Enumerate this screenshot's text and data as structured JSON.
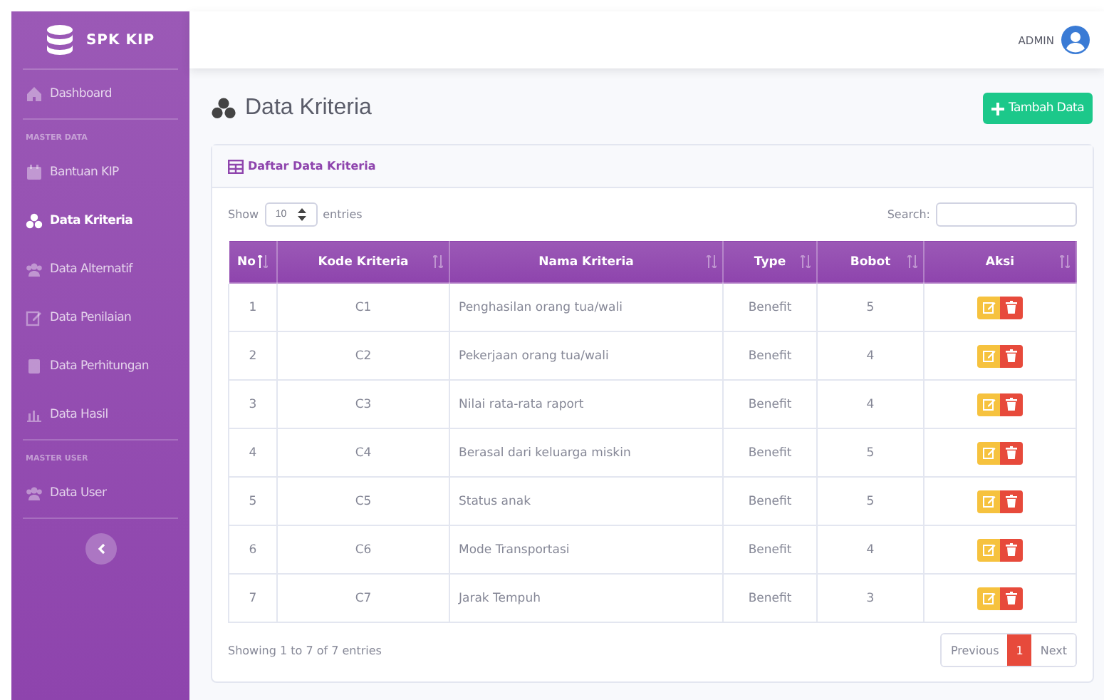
{
  "sidebar": {
    "brand": "SPK KIP",
    "nav": [
      {
        "kind": "link",
        "label": "Dashboard",
        "selected": false
      },
      {
        "kind": "divider"
      },
      {
        "kind": "heading",
        "label": "MASTER DATA"
      },
      {
        "kind": "link",
        "label": "Bantuan KIP",
        "selected": false
      },
      {
        "kind": "link",
        "label": "Data Kriteria",
        "selected": true
      },
      {
        "kind": "link",
        "label": "Data Alternatif",
        "selected": false
      },
      {
        "kind": "link",
        "label": "Data Penilaian",
        "selected": false
      },
      {
        "kind": "link",
        "label": "Data Perhitungan",
        "selected": false
      },
      {
        "kind": "link",
        "label": "Data Hasil",
        "selected": false
      },
      {
        "kind": "divider"
      },
      {
        "kind": "heading",
        "label": "MASTER USER"
      },
      {
        "kind": "link",
        "label": "Data User",
        "selected": false
      },
      {
        "kind": "divider"
      }
    ]
  },
  "topbar": {
    "user": "ADMIN"
  },
  "page": {
    "title": "Data Kriteria",
    "add_button": "Tambah Data"
  },
  "card": {
    "title": "Daftar Data Kriteria",
    "show_label": "Show",
    "page_size": "10",
    "entries_label": "entries",
    "search_label": "Search:",
    "columns": [
      {
        "label": "No",
        "sorted": true
      },
      {
        "label": "Kode Kriteria",
        "sorted": false
      },
      {
        "label": "Nama Kriteria",
        "sorted": false
      },
      {
        "label": "Type",
        "sorted": false
      },
      {
        "label": "Bobot",
        "sorted": false
      },
      {
        "label": "Aksi",
        "sorted": false
      }
    ],
    "rows": [
      [
        "1",
        "C1",
        "Penghasilan orang tua/wali",
        "Benefit",
        "5"
      ],
      [
        "2",
        "C2",
        "Pekerjaan orang tua/wali",
        "Benefit",
        "4"
      ],
      [
        "3",
        "C3",
        "Nilai rata-rata raport",
        "Benefit",
        "4"
      ],
      [
        "4",
        "C4",
        "Berasal dari keluarga miskin",
        "Benefit",
        "5"
      ],
      [
        "5",
        "C5",
        "Status anak",
        "Benefit",
        "5"
      ],
      [
        "6",
        "C6",
        "Mode Transportasi",
        "Benefit",
        "4"
      ],
      [
        "7",
        "C7",
        "Jarak Tempuh",
        "Benefit",
        "3"
      ]
    ],
    "info": "Showing 1 to 7 of 7 entries",
    "pagination": [
      {
        "label": "Previous",
        "selected": false
      },
      {
        "label": "1",
        "selected": true
      },
      {
        "label": "Next",
        "selected": false
      }
    ]
  }
}
